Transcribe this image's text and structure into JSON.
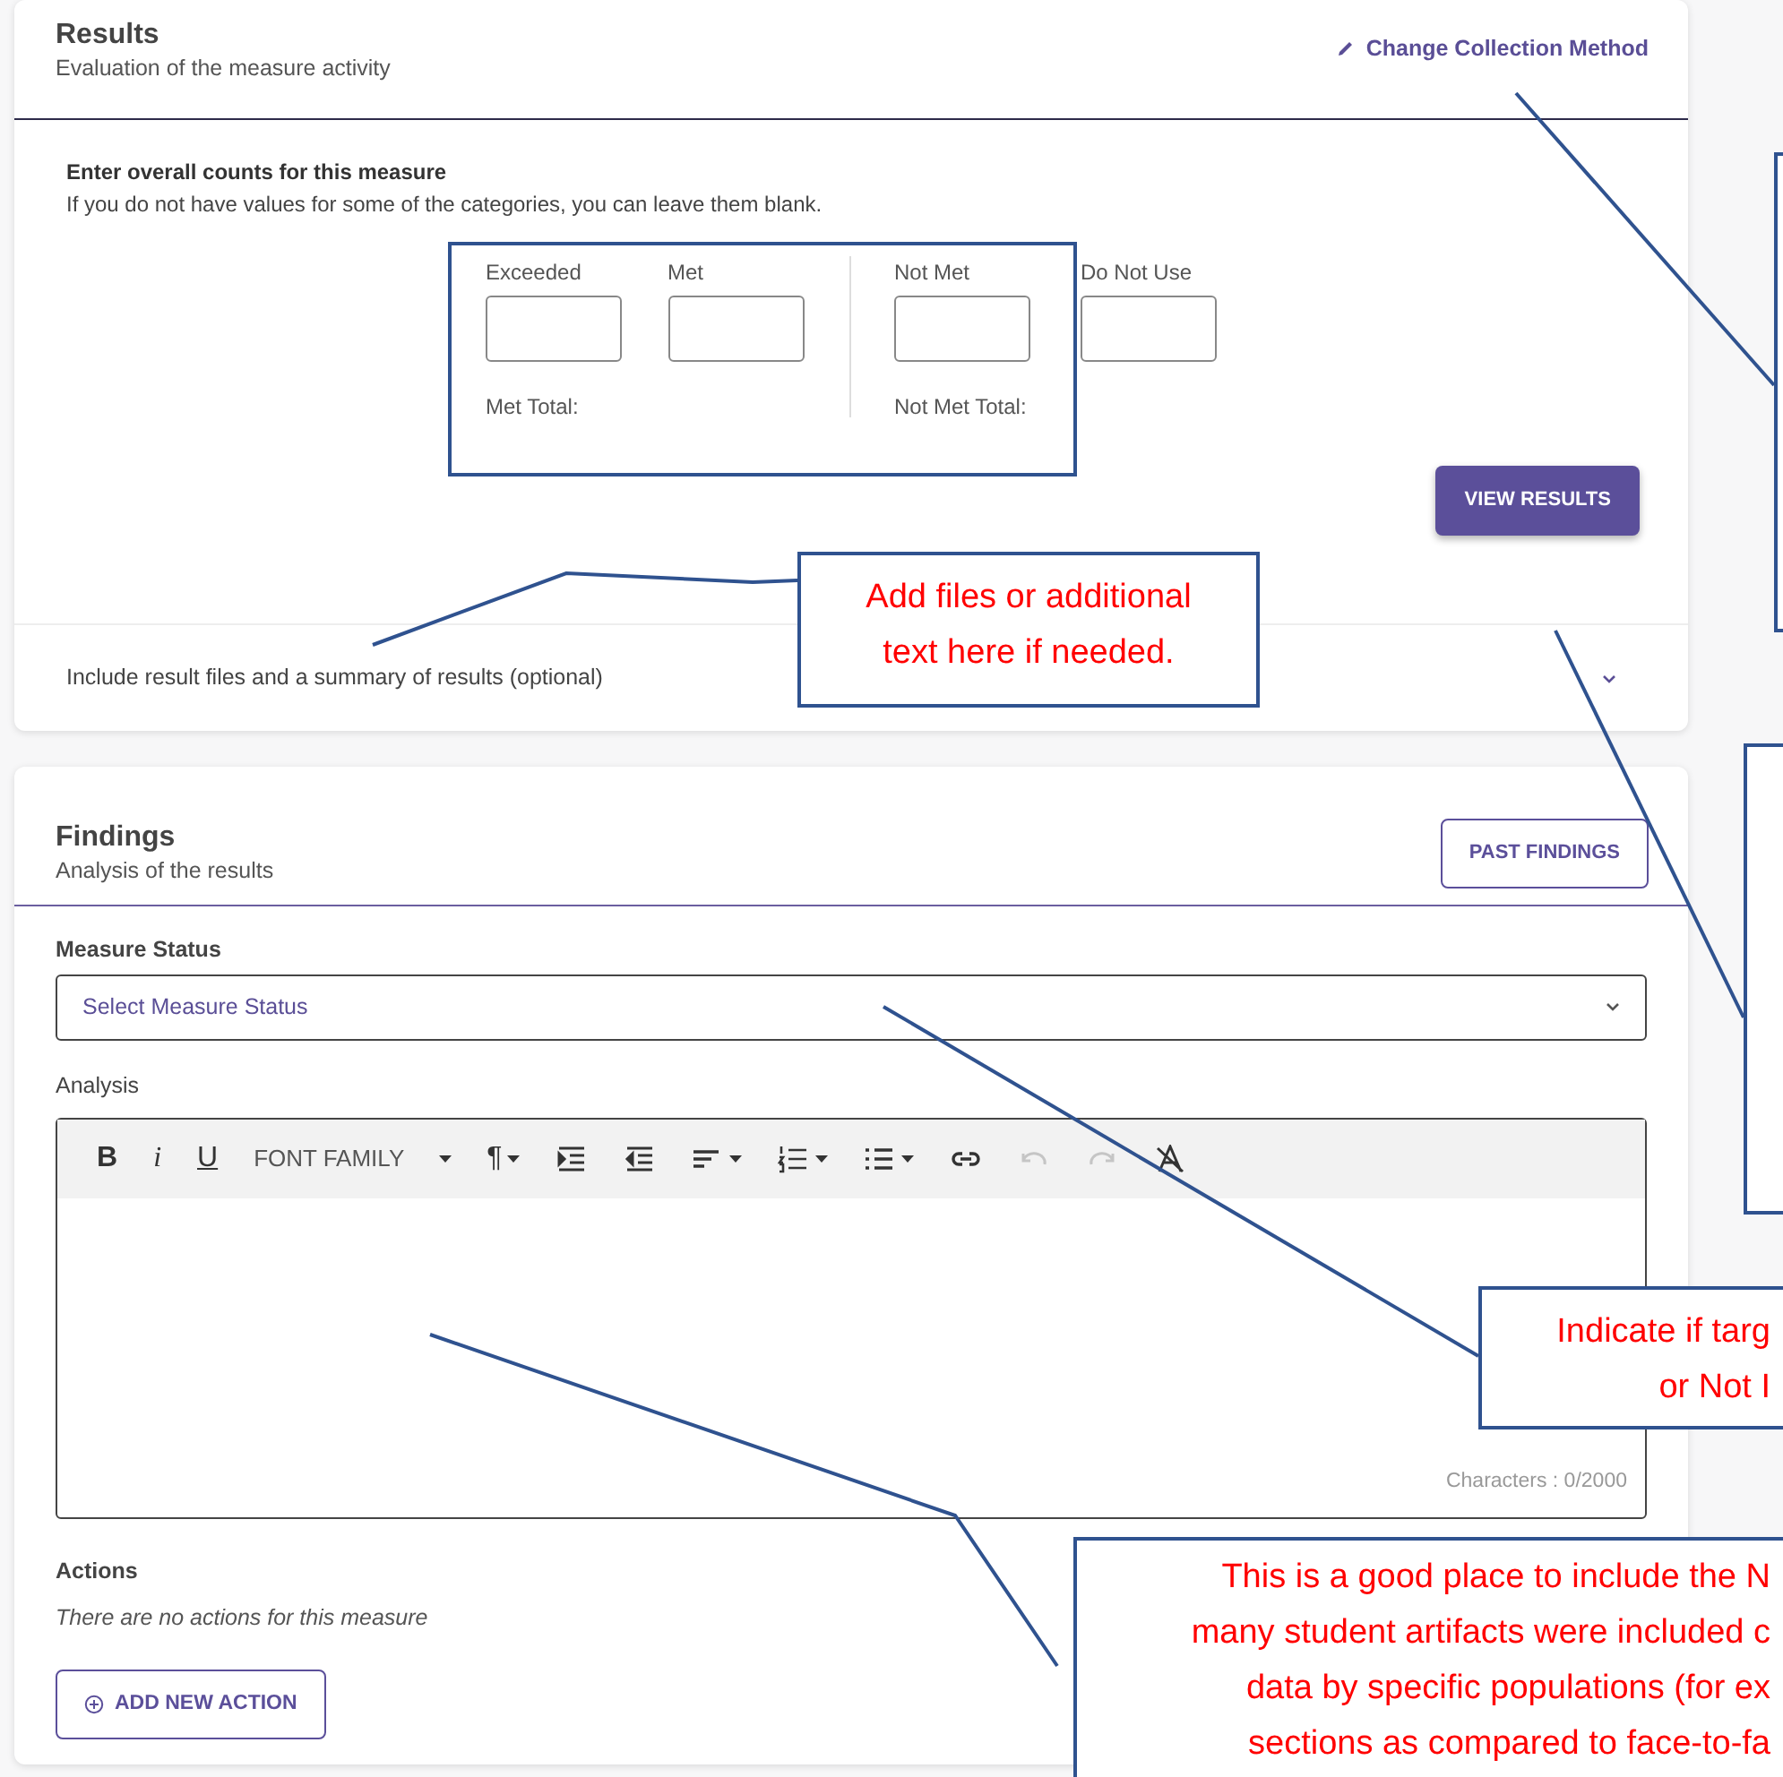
{
  "results_card": {
    "title": "Results",
    "subtitle": "Evaluation of the measure activity",
    "action_link": "Change Collection Method",
    "counts_heading": "Enter overall counts for this measure",
    "counts_hint": "If you do not have values for some of the categories, you can leave them blank.",
    "count_fields": [
      {
        "label": "Exceeded"
      },
      {
        "label": "Met"
      },
      {
        "label": "Not Met"
      },
      {
        "label": "Do Not Use"
      }
    ],
    "totals": [
      "Met Total:",
      "Not Met Total:"
    ],
    "view_button": "VIEW RESULTS",
    "collapsible": {
      "label": "Include result files and a summary of results (optional)",
      "expanded": false
    }
  },
  "findings_card": {
    "title": "Findings",
    "subtitle": "Analysis of the results",
    "past_button": "PAST FINDINGS",
    "status_label": "Measure Status",
    "status_placeholder": "Select Measure Status",
    "analysis_label": "Analysis",
    "toolbar": [
      {
        "kind": "bold",
        "label": "B",
        "dropdown": false,
        "disabled": false
      },
      {
        "kind": "italic",
        "label": "i",
        "dropdown": false,
        "disabled": false
      },
      {
        "kind": "underline",
        "label": "U",
        "dropdown": false,
        "disabled": false
      },
      {
        "kind": "font",
        "label": "FONT FAMILY",
        "dropdown": true,
        "disabled": false
      },
      {
        "kind": "paragraph",
        "label": "¶",
        "dropdown": true,
        "disabled": false
      },
      {
        "kind": "indent",
        "dropdown": false,
        "disabled": false
      },
      {
        "kind": "outdent",
        "dropdown": false,
        "disabled": false
      },
      {
        "kind": "align",
        "dropdown": true,
        "disabled": false
      },
      {
        "kind": "ordered-list",
        "dropdown": true,
        "disabled": false
      },
      {
        "kind": "bullet-list",
        "dropdown": true,
        "disabled": false
      },
      {
        "kind": "link",
        "dropdown": false,
        "disabled": false
      },
      {
        "kind": "undo",
        "dropdown": false,
        "disabled": true
      },
      {
        "kind": "redo",
        "dropdown": false,
        "disabled": true
      },
      {
        "kind": "clear-format",
        "dropdown": false,
        "disabled": false
      }
    ],
    "char_count": "Characters : 0/2000",
    "actions_label": "Actions",
    "actions_empty": "There are no actions for this measure",
    "add_button": "ADD NEW ACTION"
  },
  "callouts": [
    {
      "kind": "text",
      "lines": [
        "Add files or additional",
        "text here if needed."
      ]
    },
    {
      "kind": "empty"
    },
    {
      "kind": "empty"
    },
    {
      "kind": "text",
      "lines": [
        "Indicate if targ",
        "or Not I"
      ]
    },
    {
      "kind": "text",
      "lines": [
        "This is a good place to include the N",
        "many student artifacts were included c",
        "data by specific populations (for ex",
        "sections as compared to face-to-fa"
      ]
    }
  ]
}
